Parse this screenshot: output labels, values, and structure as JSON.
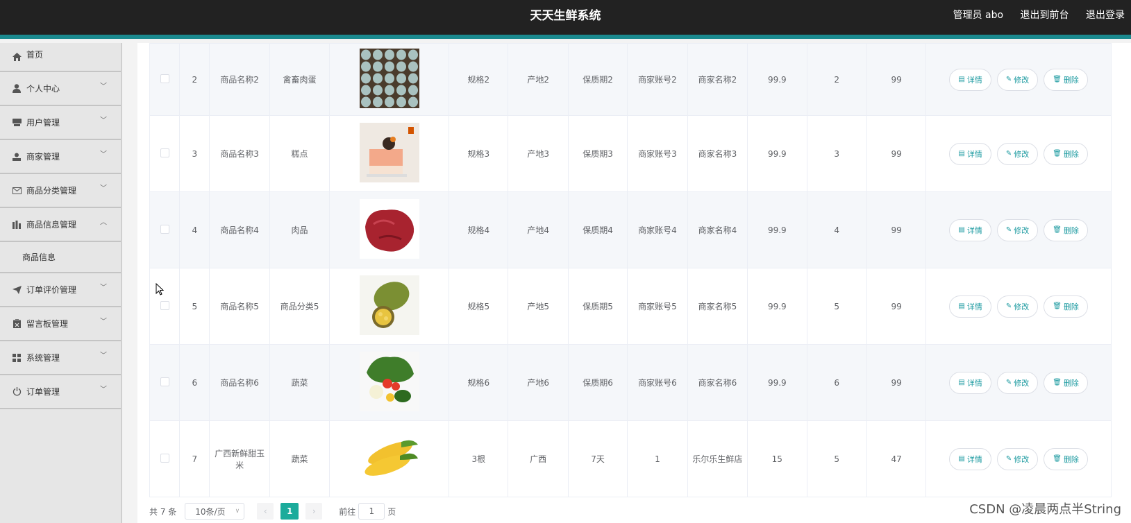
{
  "header": {
    "title": "天天生鲜系统",
    "user": "管理员 abo",
    "to_front": "退出到前台",
    "logout": "退出登录"
  },
  "sidebar": {
    "items": [
      {
        "label": "首页",
        "icon": "home-icon"
      },
      {
        "label": "个人中心",
        "icon": "user-icon"
      },
      {
        "label": "用户管理",
        "icon": "users-icon"
      },
      {
        "label": "商家管理",
        "icon": "merchant-icon"
      },
      {
        "label": "商品分类管理",
        "icon": "mail-icon"
      },
      {
        "label": "商品信息管理",
        "icon": "chart-icon",
        "expanded": true
      },
      {
        "label": "订单评价管理",
        "icon": "send-icon"
      },
      {
        "label": "留言板管理",
        "icon": "clipboard-icon"
      },
      {
        "label": "系统管理",
        "icon": "grid-icon"
      },
      {
        "label": "订单管理",
        "icon": "power-icon"
      }
    ],
    "subitem": "商品信息"
  },
  "table": {
    "rows": [
      {
        "id": "2",
        "name": "商品名称2",
        "category": "禽畜肉蛋",
        "image": "eggs-image",
        "spec": "规格2",
        "origin": "产地2",
        "shelf": "保质期2",
        "account": "商家账号2",
        "merchant": "商家名称2",
        "price": "99.9",
        "c1": "2",
        "c2": "99"
      },
      {
        "id": "3",
        "name": "商品名称3",
        "category": "糕点",
        "image": "cake-image",
        "spec": "规格3",
        "origin": "产地3",
        "shelf": "保质期3",
        "account": "商家账号3",
        "merchant": "商家名称3",
        "price": "99.9",
        "c1": "3",
        "c2": "99"
      },
      {
        "id": "4",
        "name": "商品名称4",
        "category": "肉品",
        "image": "meat-image",
        "spec": "规格4",
        "origin": "产地4",
        "shelf": "保质期4",
        "account": "商家账号4",
        "merchant": "商家名称4",
        "price": "99.9",
        "c1": "4",
        "c2": "99"
      },
      {
        "id": "5",
        "name": "商品名称5",
        "category": "商品分类5",
        "image": "jackfruit-image",
        "spec": "规格5",
        "origin": "产地5",
        "shelf": "保质期5",
        "account": "商家账号5",
        "merchant": "商家名称5",
        "price": "99.9",
        "c1": "5",
        "c2": "99"
      },
      {
        "id": "6",
        "name": "商品名称6",
        "category": "蔬菜",
        "image": "vegetables-image",
        "spec": "规格6",
        "origin": "产地6",
        "shelf": "保质期6",
        "account": "商家账号6",
        "merchant": "商家名称6",
        "price": "99.9",
        "c1": "6",
        "c2": "99"
      },
      {
        "id": "7",
        "name": "广西新鲜甜玉米",
        "category": "蔬菜",
        "image": "corn-image",
        "spec": "3根",
        "origin": "广西",
        "shelf": "7天",
        "account": "1",
        "merchant": "乐尔乐生鲜店",
        "price": "15",
        "c1": "5",
        "c2": "47"
      }
    ],
    "actions": {
      "detail": "详情",
      "edit": "修改",
      "delete": "删除"
    }
  },
  "pager": {
    "total": "共 7 条",
    "page_size": "10条/页",
    "current_page": "1",
    "goto_prefix": "前往",
    "goto_value": "1",
    "goto_suffix": "页"
  },
  "watermark": "CSDN @凌晨两点半String",
  "colors": {
    "accent": "#1b9aa0",
    "topbar": "#222222",
    "topbar_border": "#1b8a8f",
    "page_active": "#1bab9b"
  }
}
